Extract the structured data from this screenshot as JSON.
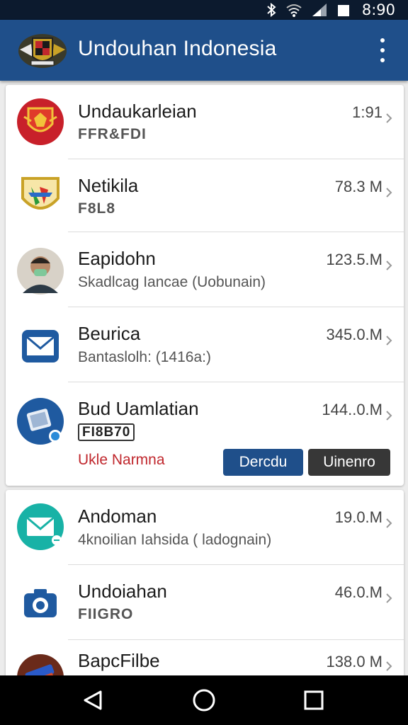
{
  "status_bar": {
    "time": "8:90",
    "icons": [
      "bluetooth-icon",
      "wifi-icon",
      "signal-icon",
      "battery-icon"
    ]
  },
  "app_bar": {
    "title": "Undouhan Indonesia",
    "logo": "garuda-emblem-icon",
    "menu": "overflow-menu-icon"
  },
  "downloads": [
    {
      "name": "Undaukarleian",
      "size": "1:91",
      "badge": "FFR&FDI",
      "badge_style": "yellow",
      "icon": "garuda-shield-icon"
    },
    {
      "name": "Netikila",
      "size": "78.3 M",
      "badge": "F8L8",
      "badge_style": "green",
      "icon": "colorful-shield-icon"
    },
    {
      "name": "Eapidohn",
      "size": "123.5.M",
      "subtitle": "Skadlcag Iancae (Uobunain)",
      "icon": "person-avatar-icon"
    },
    {
      "name": "Beurica",
      "size": "345.0.M",
      "subtitle": "Bantaslolh: (1416a:)",
      "icon": "mail-icon"
    },
    {
      "name": "Bud Uamlatian",
      "size": "144..0.M",
      "badge": "FI8B70",
      "badge_style": "box",
      "subtitle": "Ukle Narmna",
      "icon": "phone-app-icon",
      "buttons": {
        "details": "Dercdu",
        "uninstall": "Uinenro"
      }
    }
  ],
  "downloads_2": [
    {
      "name": "Andoman",
      "size": "19.0.M",
      "subtitle": "4knoilian Iahsida ( ladognain)",
      "icon": "teal-mail-icon"
    },
    {
      "name": "Undoiahan",
      "size": "46.0.M",
      "badge": "FIIGRO",
      "badge_style": "orange",
      "icon": "camera-icon"
    },
    {
      "name": "BapcFilbe",
      "size": "138.0 M",
      "icon": "book-icon"
    }
  ],
  "nav_bar": {
    "back": "back-icon",
    "home": "home-icon",
    "recents": "recents-icon"
  },
  "colors": {
    "app_bar": "#1f4f8a",
    "status_bar": "#0c1a2e",
    "details_button": "#1f4f8a",
    "uninstall_button": "#373737"
  }
}
